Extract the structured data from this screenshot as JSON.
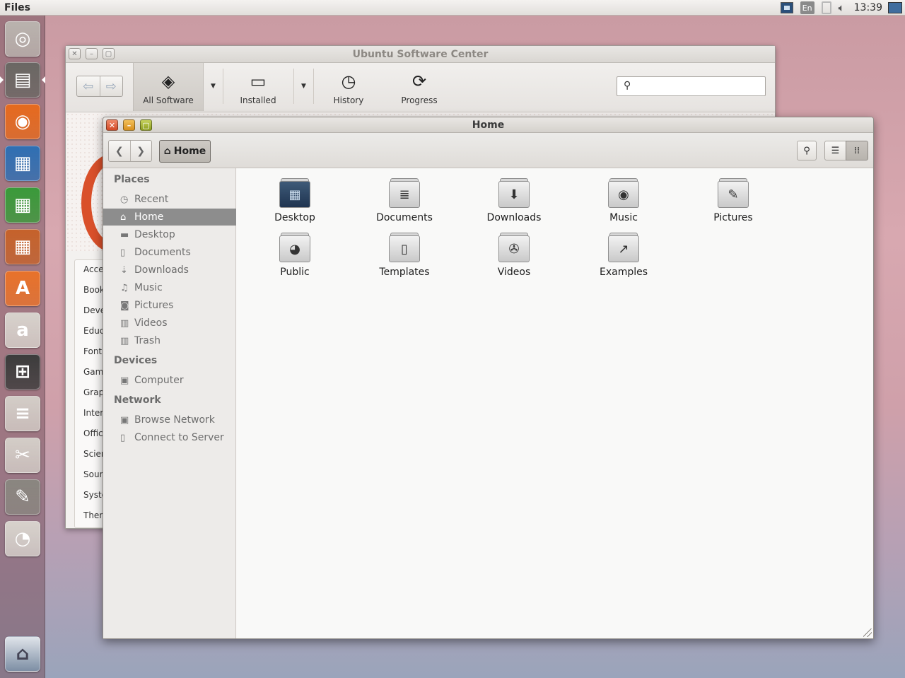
{
  "top_panel": {
    "app_name": "Files",
    "lang": "En",
    "clock": "13:39"
  },
  "launcher": {
    "items": [
      {
        "name": "dash-home",
        "glyph": "◎",
        "color": "#b9b3ae"
      },
      {
        "name": "files",
        "glyph": "▤",
        "color": "#6a6763"
      },
      {
        "name": "firefox",
        "glyph": "◉",
        "color": "#e66a1e"
      },
      {
        "name": "writer",
        "glyph": "▦",
        "color": "#2f6fb3"
      },
      {
        "name": "calc",
        "glyph": "▦",
        "color": "#3a9a3a"
      },
      {
        "name": "impress",
        "glyph": "▦",
        "color": "#c5622b"
      },
      {
        "name": "software-center",
        "glyph": "A",
        "color": "#e8722a"
      },
      {
        "name": "amazon",
        "glyph": "a",
        "color": "#d7d2cc"
      },
      {
        "name": "system-settings",
        "glyph": "⊞",
        "color": "#3c3c3c"
      },
      {
        "name": "mixer",
        "glyph": "≡",
        "color": "#d3cdc7"
      },
      {
        "name": "tool",
        "glyph": "✂",
        "color": "#d3cdc7"
      },
      {
        "name": "gimp",
        "glyph": "✎",
        "color": "#8a8680"
      },
      {
        "name": "disc",
        "glyph": "◔",
        "color": "#d7d2cc"
      }
    ],
    "trash_glyph": "⌂"
  },
  "usc": {
    "title": "Ubuntu Software Center",
    "toolbar": {
      "all_software": "All Software",
      "installed": "Installed",
      "history": "History",
      "progress": "Progress"
    },
    "categories": [
      "Acce",
      "Book",
      "Deve",
      "Educ",
      "Font",
      "Gam",
      "Grap",
      "Inter",
      "Offic",
      "Scier",
      "Soun",
      "Syste",
      "Then"
    ]
  },
  "home": {
    "title": "Home",
    "breadcrumb": "Home",
    "sidebar": {
      "places_heading": "Places",
      "places": [
        {
          "label": "Recent",
          "icon": "◷"
        },
        {
          "label": "Home",
          "icon": "⌂"
        },
        {
          "label": "Desktop",
          "icon": "▬"
        },
        {
          "label": "Documents",
          "icon": "▯"
        },
        {
          "label": "Downloads",
          "icon": "⇣"
        },
        {
          "label": "Music",
          "icon": "♫"
        },
        {
          "label": "Pictures",
          "icon": "◙"
        },
        {
          "label": "Videos",
          "icon": "▥"
        },
        {
          "label": "Trash",
          "icon": "▥"
        }
      ],
      "devices_heading": "Devices",
      "devices": [
        {
          "label": "Computer",
          "icon": "▣"
        }
      ],
      "network_heading": "Network",
      "network": [
        {
          "label": "Browse Network",
          "icon": "▣"
        },
        {
          "label": "Connect to Server",
          "icon": "▯"
        }
      ]
    },
    "items": [
      {
        "label": "Desktop",
        "glyph": "▦"
      },
      {
        "label": "Documents",
        "glyph": "≣"
      },
      {
        "label": "Downloads",
        "glyph": "⬇"
      },
      {
        "label": "Music",
        "glyph": "◉"
      },
      {
        "label": "Pictures",
        "glyph": "✎"
      },
      {
        "label": "Public",
        "glyph": "◕"
      },
      {
        "label": "Templates",
        "glyph": "▯"
      },
      {
        "label": "Videos",
        "glyph": "✇"
      },
      {
        "label": "Examples",
        "glyph": "↗"
      }
    ]
  },
  "colors": {
    "selection": "#8d8d8d",
    "accent_orange": "#dd4814"
  }
}
